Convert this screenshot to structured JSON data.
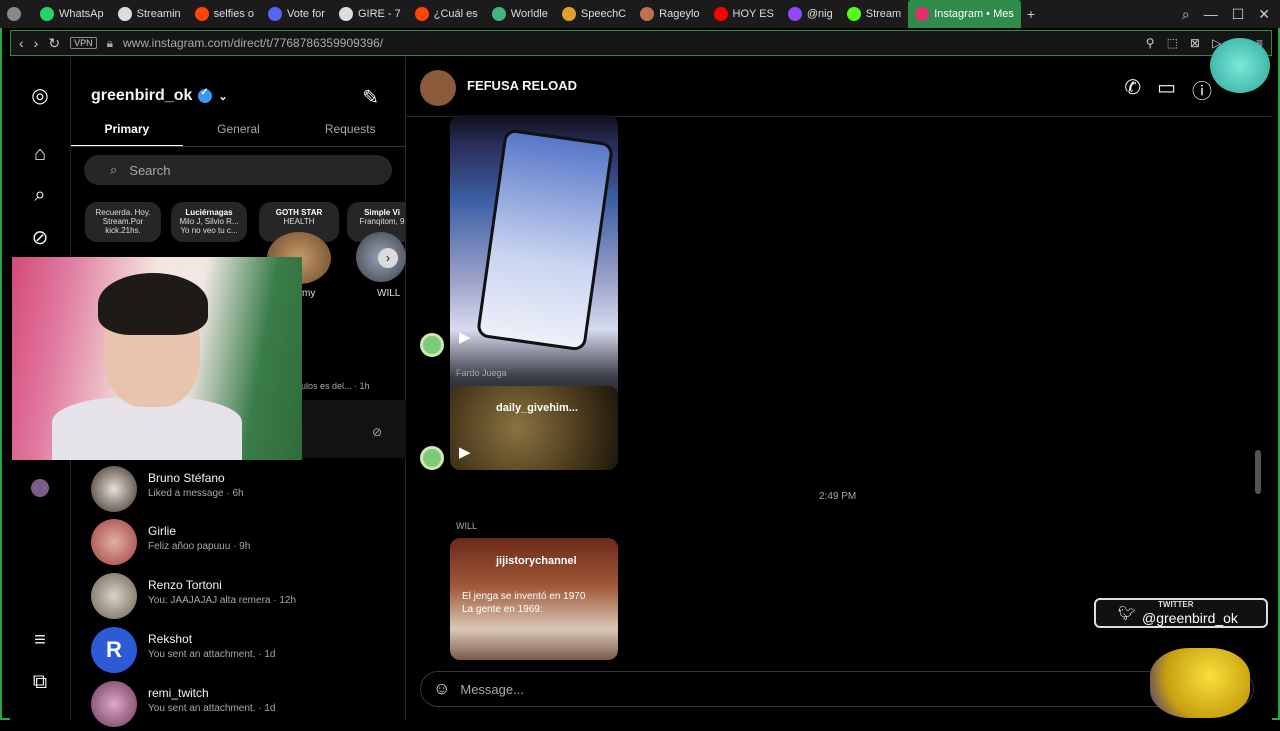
{
  "browser": {
    "tabs": [
      {
        "label": "",
        "icon": "window-icon",
        "color": "#888888"
      },
      {
        "label": "WhatsAp",
        "icon": "whatsapp-icon",
        "color": "#25d366"
      },
      {
        "label": "Streamin",
        "icon": "w-icon",
        "color": "#dddddd"
      },
      {
        "label": "selfies o",
        "icon": "reddit-icon",
        "color": "#ff4500"
      },
      {
        "label": "Vote for",
        "icon": "discord-icon",
        "color": "#5865f2"
      },
      {
        "label": "GIRE - 7",
        "icon": "trend-icon",
        "color": "#dddddd"
      },
      {
        "label": "¿Cuál es",
        "icon": "reddit-icon",
        "color": "#ff4500"
      },
      {
        "label": "Worldle",
        "icon": "globe-icon",
        "color": "#43b581"
      },
      {
        "label": "SpeechC",
        "icon": "speech-icon",
        "color": "#e0a030"
      },
      {
        "label": "Rageylo",
        "icon": "rage-icon",
        "color": "#c07050"
      },
      {
        "label": "HOY ES",
        "icon": "youtube-icon",
        "color": "#ff0000"
      },
      {
        "label": "@nig",
        "icon": "twitch-icon",
        "color": "#9146ff"
      },
      {
        "label": "Stream",
        "icon": "kick-icon",
        "color": "#53fc18"
      },
      {
        "label": "Instagram • Mes",
        "icon": "instagram-icon",
        "color": "#e1306c",
        "active": true
      }
    ],
    "url": "www.instagram.com/direct/t/7768786359909396/",
    "vpn_label": "VPN"
  },
  "inbox": {
    "username": "greenbird_ok",
    "tabs": [
      "Primary",
      "General",
      "Requests"
    ],
    "search_placeholder": "Search",
    "notes": [
      {
        "lines": [
          "Recuerda. Hoy.",
          "Stream.Por",
          "kick.21hs."
        ]
      },
      {
        "lines": [
          "Luciérnagas",
          "Milo J, Silvio R...",
          "Yo no veo tu c..."
        ]
      },
      {
        "lines": [
          "GOTH STAR",
          "HEALTH"
        ]
      },
      {
        "lines": [
          "Simple Vi",
          "Franqitom, 9"
        ]
      }
    ],
    "note_names": [
      "my",
      "WILL"
    ],
    "hidden_snippet": "ulos es del... · 1h",
    "conversations": [
      {
        "name": "Bruno Stéfano",
        "preview": "Liked a message · 6h"
      },
      {
        "name": "Girlie",
        "preview": "Feliz añoo papuuu · 9h"
      },
      {
        "name": "Renzo Tortoni",
        "preview": "You: JAAJAJAJ alta remera · 12h"
      },
      {
        "name": "Rekshot",
        "preview": "You sent an attachment. · 1d"
      },
      {
        "name": "remi_twitch",
        "preview": "You sent an attachment. · 1d"
      }
    ]
  },
  "chat": {
    "title": "FEFUSA RELOAD",
    "messages": [
      {
        "sender": "",
        "kind": "reel"
      },
      {
        "sender": "Fardo Juega",
        "kind": "reel",
        "title": "daily_givehim..."
      },
      {
        "timestamp": "2:49 PM"
      },
      {
        "sender": "WILL",
        "kind": "reel",
        "title": "jijistorychannel",
        "caption": [
          "El jenga se inventó en 1970",
          "La gente en 1969:"
        ]
      }
    ],
    "composer_placeholder": "Message..."
  },
  "overlay": {
    "twitter_label": "TWITTER",
    "twitter_handle": "@greenbird_ok"
  }
}
